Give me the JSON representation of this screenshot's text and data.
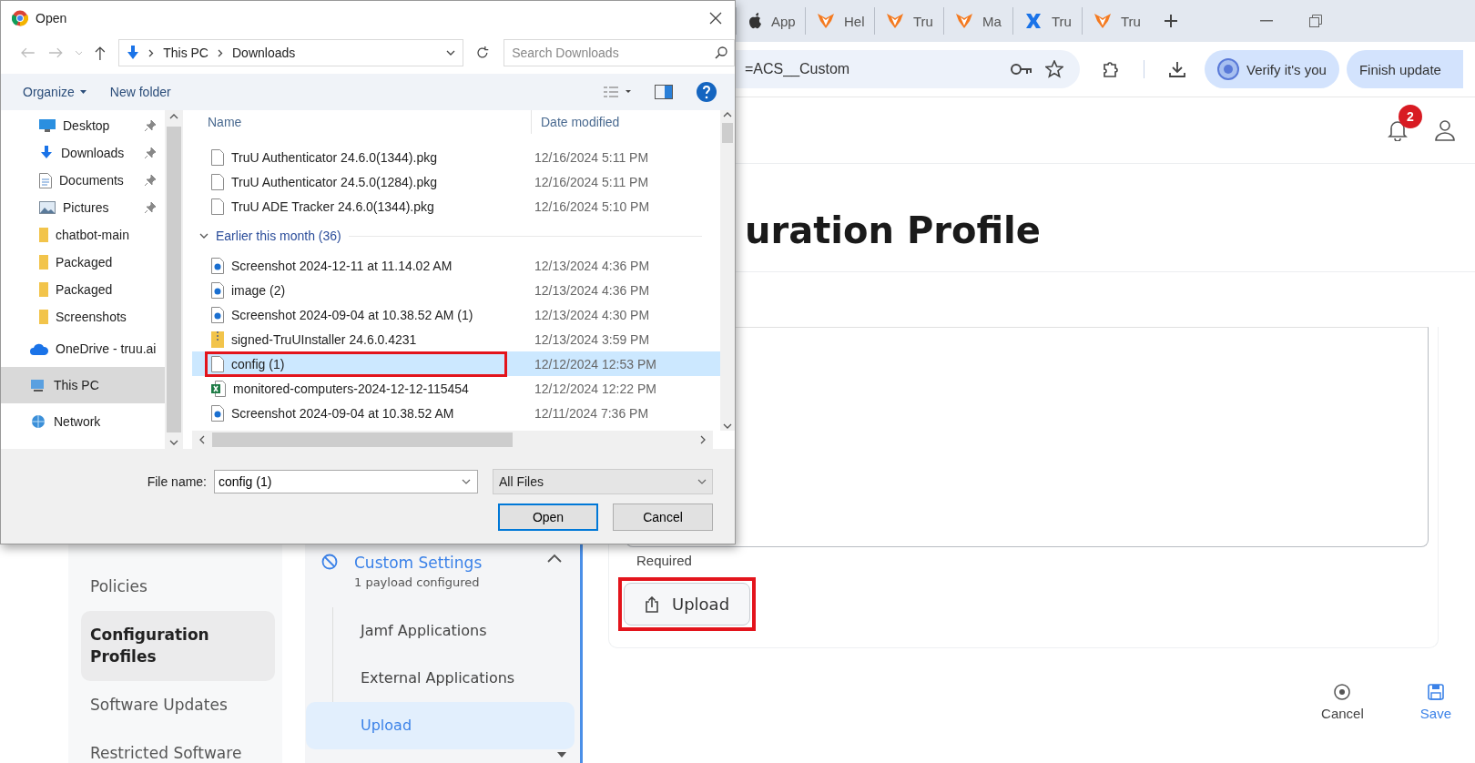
{
  "browser": {
    "tabs": [
      {
        "label": "App",
        "kind": "apple"
      },
      {
        "label": "Hel",
        "kind": "brand"
      },
      {
        "label": "Tru",
        "kind": "brand"
      },
      {
        "label": "Ma",
        "kind": "brand"
      },
      {
        "label": "Tru",
        "kind": "cross"
      },
      {
        "label": "Tru",
        "kind": "brand"
      }
    ],
    "address": "=ACS__Custom",
    "verify_button": "Verify it's you",
    "update_button": "Finish update"
  },
  "header": {
    "notification_count": "2"
  },
  "page_title": "uration Profile",
  "nav": {
    "items": [
      {
        "label": "Policies",
        "selected": false
      },
      {
        "label": "Configuration Profiles",
        "selected": true
      },
      {
        "label": "Software Updates",
        "selected": false
      },
      {
        "label": "Restricted Software",
        "selected": false
      }
    ]
  },
  "payloads": {
    "title": "Custom Settings",
    "subtitle": "1 payload configured",
    "expanded": true,
    "items": [
      {
        "label": "Jamf Applications",
        "selected": false
      },
      {
        "label": "External Applications",
        "selected": false
      },
      {
        "label": "Upload",
        "selected": true
      }
    ]
  },
  "form": {
    "hint": "Required",
    "upload_button": "Upload",
    "highlighted": true
  },
  "footer": {
    "cancel": "Cancel",
    "save": "Save"
  },
  "dialog": {
    "title": "Open",
    "path": [
      "This PC",
      "Downloads"
    ],
    "search_placeholder": "Search Downloads",
    "commands": [
      "Organize",
      "New folder"
    ],
    "nav": [
      {
        "label": "Desktop",
        "kind": "desktop",
        "pinned": true,
        "selected": false
      },
      {
        "label": "Downloads",
        "kind": "download",
        "pinned": true,
        "selected": false
      },
      {
        "label": "Documents",
        "kind": "document",
        "pinned": true,
        "selected": false
      },
      {
        "label": "Pictures",
        "kind": "picture",
        "pinned": true,
        "selected": false
      },
      {
        "label": "chatbot-main",
        "kind": "folder",
        "pinned": false,
        "selected": false
      },
      {
        "label": "Packaged",
        "kind": "folder",
        "pinned": false,
        "selected": false
      },
      {
        "label": "Packaged",
        "kind": "folder",
        "pinned": false,
        "selected": false
      },
      {
        "label": "Screenshots",
        "kind": "folder",
        "pinned": false,
        "selected": false
      },
      {
        "label": "OneDrive - truu.ai",
        "kind": "cloud",
        "pinned": false,
        "selected": false
      },
      {
        "label": "This PC",
        "kind": "pc",
        "pinned": false,
        "selected": true
      },
      {
        "label": "Network",
        "kind": "network",
        "pinned": false,
        "selected": false
      }
    ],
    "columns": [
      "Name",
      "Date modified"
    ],
    "rows": [
      {
        "kind": "file",
        "name": "TruU Authenticator 24.6.0(1344).pkg",
        "date": "12/16/2024 5:11 PM",
        "selected": false,
        "highlighted": false
      },
      {
        "kind": "file",
        "name": "TruU Authenticator 24.5.0(1284).pkg",
        "date": "12/16/2024 5:11 PM",
        "selected": false,
        "highlighted": false
      },
      {
        "kind": "file",
        "name": "TruU ADE Tracker 24.6.0(1344).pkg",
        "date": "12/16/2024 5:10 PM",
        "selected": false,
        "highlighted": false
      },
      {
        "kind": "group",
        "label": "Earlier this month (36)",
        "expanded": true
      },
      {
        "kind": "image",
        "name": "Screenshot 2024-12-11 at 11.14.02 AM",
        "date": "12/13/2024 4:36 PM",
        "selected": false,
        "highlighted": false
      },
      {
        "kind": "image",
        "name": "image (2)",
        "date": "12/13/2024 4:36 PM",
        "selected": false,
        "highlighted": false
      },
      {
        "kind": "image",
        "name": "Screenshot 2024-09-04 at 10.38.52 AM (1)",
        "date": "12/13/2024 4:30 PM",
        "selected": false,
        "highlighted": false
      },
      {
        "kind": "archive",
        "name": "signed-TruUInstaller 24.6.0.4231",
        "date": "12/13/2024 3:59 PM",
        "selected": false,
        "highlighted": false
      },
      {
        "kind": "file",
        "name": "config (1)",
        "date": "12/12/2024 12:53 PM",
        "selected": true,
        "highlighted": true
      },
      {
        "kind": "sheet",
        "name": "monitored-computers-2024-12-12-115454",
        "date": "12/12/2024 12:22 PM",
        "selected": false,
        "highlighted": false
      },
      {
        "kind": "image",
        "name": "Screenshot 2024-09-04 at 10.38.52 AM",
        "date": "12/11/2024 7:36 PM",
        "selected": false,
        "highlighted": false
      }
    ],
    "file_name_label": "File name:",
    "file_name": "config (1)",
    "file_type": "All Files",
    "buttons": [
      "Open",
      "Cancel"
    ]
  }
}
